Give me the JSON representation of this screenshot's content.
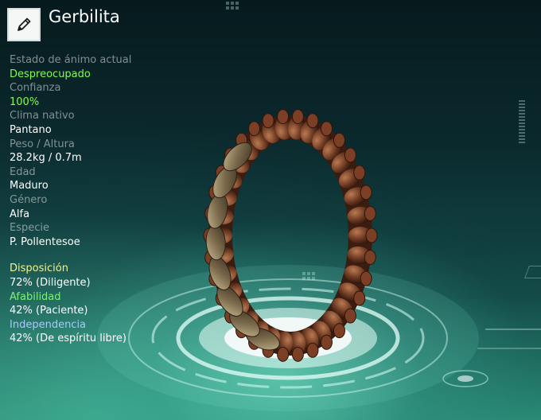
{
  "header": {
    "title": "Gerbilita",
    "edit_icon": "pencil-icon"
  },
  "info_fields": [
    {
      "label": "Estado de ánimo actual",
      "value": "Despreocupado",
      "value_color": "#7dff4c"
    },
    {
      "label": "Confianza",
      "value": "100%",
      "value_color": "#7dff4c"
    },
    {
      "label": "Clima nativo",
      "value": "Pantano"
    },
    {
      "label": "Peso / Altura",
      "value": "28.2kg / 0.7m"
    },
    {
      "label": "Edad",
      "value": "Maduro"
    },
    {
      "label": "Género",
      "value": "Alfa"
    },
    {
      "label": "Especie",
      "value": "P. Pollentesoe"
    }
  ],
  "traits": [
    {
      "label": "Disposición",
      "value": "72% (Diligente)",
      "label_color": "#f3f28a"
    },
    {
      "label": "Afabilidad",
      "value": "42% (Paciente)",
      "label_color": "#7ef07a"
    },
    {
      "label": "Independencia",
      "value": "42% (De espíritu libre)",
      "label_color": "#a9c8ff"
    }
  ]
}
